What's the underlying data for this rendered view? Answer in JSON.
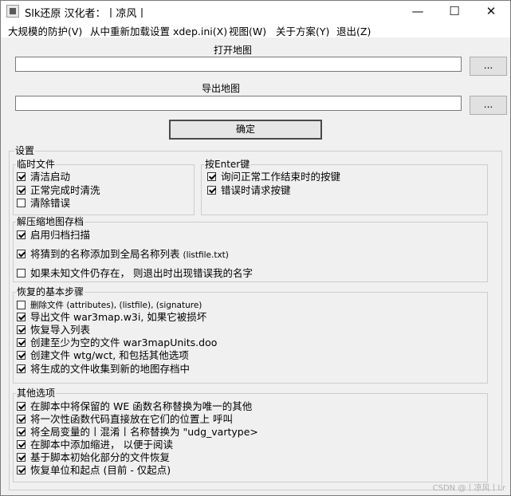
{
  "titlebar": {
    "title": "Slk还原 汉化者：丨凉风丨",
    "minimize": "—",
    "maximize": "☐",
    "close": "✕"
  },
  "menu": [
    {
      "label": "大规模的防护(V)"
    },
    {
      "label": "从中重新加载设置 xdep.ini(X)"
    },
    {
      "label": "视图(W)"
    },
    {
      "label": "关于方案(Y)"
    },
    {
      "label": "退出(Z)"
    }
  ],
  "open_map": {
    "label": "打开地图",
    "value": "",
    "browse": "..."
  },
  "export_map": {
    "label": "导出地图",
    "value": "",
    "browse": "..."
  },
  "confirm_label": "确定",
  "settings": {
    "legend": "设置",
    "temp_files": {
      "legend": "临时文件",
      "items": [
        {
          "label": "清洁启动",
          "checked": true
        },
        {
          "label": "正常完成时清洗",
          "checked": true
        },
        {
          "label": "清除错误",
          "checked": false
        }
      ]
    },
    "press_enter": {
      "legend": "按Enter键",
      "items": [
        {
          "label": "询问正常工作结束时的按键",
          "checked": true
        },
        {
          "label": "错误时请求按键",
          "checked": true
        }
      ]
    },
    "archive": {
      "legend": "解压缩地图存档",
      "items": [
        {
          "label": "启用归档扫描",
          "checked": true
        },
        {
          "label": "将猜到的名称添加到全局名称列表",
          "extra": "(listfile.txt)",
          "checked": true
        },
        {
          "label": "如果未知文件仍存在， 则退出时出现错误我的名字",
          "checked": false
        }
      ]
    },
    "recover": {
      "legend": "恢复的基本步骤",
      "items": [
        {
          "label": "删除文件 (attributes), (listfile), (signature)",
          "checked": false
        },
        {
          "label": "导出文件 war3map.w3i, 如果它被损坏",
          "checked": true
        },
        {
          "label": "恢复导入列表",
          "checked": true
        },
        {
          "label": "创建至少为空的文件 war3mapUnits.doo",
          "checked": true
        },
        {
          "label": "创建文件 wtg/wct, 和包括其他选项",
          "checked": true
        },
        {
          "label": "将生成的文件收集到新的地图存档中",
          "checked": true
        }
      ]
    },
    "other": {
      "legend": "其他选项",
      "items": [
        {
          "label": "在脚本中将保留的 WE 函数名称替换为唯一的其他",
          "checked": true
        },
        {
          "label": "将一次性函数代码直接放在它们的位置上 呼叫",
          "checked": true
        },
        {
          "label": "将全局变量的丨混淆丨名称替换为 \"udg_vartype>",
          "checked": true
        },
        {
          "label": "在脚本中添加缩进， 以便于阅读",
          "checked": true
        },
        {
          "label": "基于脚本初始化部分的文件恢复",
          "checked": true
        },
        {
          "label": "恢复单位和起点 (目前 - 仅起点)",
          "checked": true
        }
      ]
    }
  },
  "watermark": "CSDN @丨凉风丨Lr"
}
